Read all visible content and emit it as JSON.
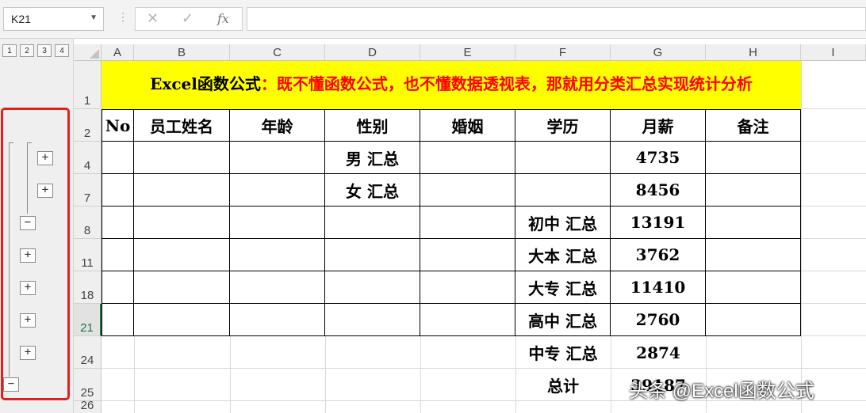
{
  "formula_bar": {
    "name_box": "K21",
    "cancel_glyph": "✕",
    "enter_glyph": "✓",
    "fx_label": "fx",
    "formula": ""
  },
  "outline": {
    "level_buttons": [
      "1",
      "2",
      "3",
      "4"
    ],
    "group_buttons": [
      "+",
      "+",
      "−",
      "+",
      "+",
      "+",
      "+",
      "−"
    ]
  },
  "column_headers": [
    "A",
    "B",
    "C",
    "D",
    "E",
    "F",
    "G",
    "H",
    "I"
  ],
  "row_headers": [
    "1",
    "2",
    "4",
    "7",
    "8",
    "11",
    "18",
    "21",
    "24",
    "25",
    "26"
  ],
  "title": {
    "prefix": "Excel函数公式",
    "rest": "：既不懂函数公式，也不懂数据透视表，那就用分类汇总实现统计分析"
  },
  "table": {
    "headers": [
      "No",
      "员工姓名",
      "年龄",
      "性别",
      "婚姻",
      "学历",
      "月薪",
      "备注"
    ],
    "rows": [
      [
        "",
        "",
        "",
        "男 汇总",
        "",
        "",
        "4735",
        ""
      ],
      [
        "",
        "",
        "",
        "女 汇总",
        "",
        "",
        "8456",
        ""
      ],
      [
        "",
        "",
        "",
        "",
        "",
        "初中 汇总",
        "13191",
        ""
      ],
      [
        "",
        "",
        "",
        "",
        "",
        "大本 汇总",
        "3762",
        ""
      ],
      [
        "",
        "",
        "",
        "",
        "",
        "大专 汇总",
        "11410",
        ""
      ],
      [
        "",
        "",
        "",
        "",
        "",
        "高中 汇总",
        "2760",
        ""
      ]
    ],
    "row24": {
      "f": "中专 汇总",
      "g": "2874"
    },
    "row25": {
      "f": "总计",
      "g": "39187"
    }
  },
  "watermark": "头条 @Excel函数公式",
  "colors": {
    "title_bg": "#ffff00",
    "title_red": "#ff0000",
    "outline_highlight": "#e0201f"
  }
}
